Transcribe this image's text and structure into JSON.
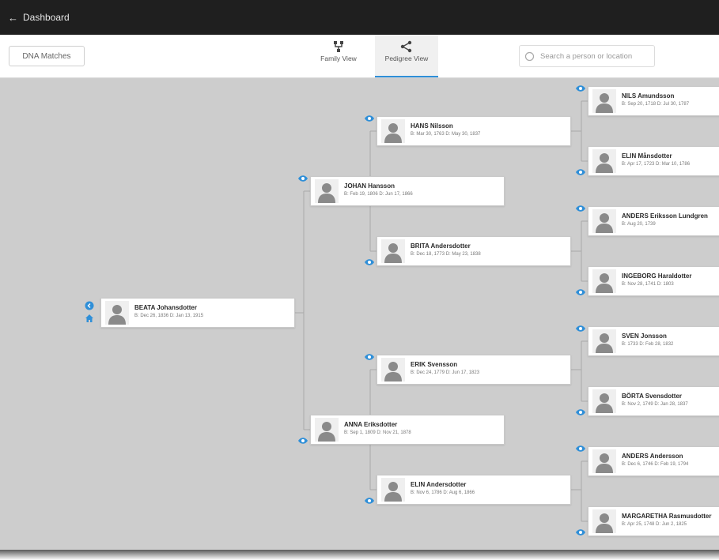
{
  "topbar": {
    "back_label": "Dashboard"
  },
  "toolbar": {
    "dna_button": "DNA Matches",
    "views": [
      {
        "label": "Family View",
        "active": false
      },
      {
        "label": "Pedigree View",
        "active": true
      }
    ],
    "search_placeholder": "Search a person or location"
  },
  "colors": {
    "accent": "#2f8fd8",
    "canvas": "#cdcdcd",
    "topbar": "#1f1f1f"
  },
  "icons": {
    "back": "arrow-left-icon",
    "family_view": "family-tree-icon",
    "pedigree_view": "pedigree-share-icon",
    "search": "search-icon",
    "focus": "target-circle-icon",
    "home": "home-icon",
    "eye": "eye-icon",
    "avatar": "person-silhouette-icon"
  },
  "tree": {
    "root": {
      "name": "BEATA Johansdotter",
      "dates": "B: Dec 26, 1836 D: Jan 13, 1915"
    },
    "parents": [
      {
        "name": "JOHAN Hansson",
        "dates": "B: Feb 19, 1806 D: Jun 17, 1866"
      },
      {
        "name": "ANNA Eriksdotter",
        "dates": "B: Sep 1, 1809 D: Nov 21, 1878"
      }
    ],
    "grandparents": [
      {
        "name": "HANS Nilsson",
        "dates": "B: Mar 30, 1763 D: May 30, 1837"
      },
      {
        "name": "BRITA Andersdotter",
        "dates": "B: Dec 18, 1773 D: May 23, 1838"
      },
      {
        "name": "ERIK Svensson",
        "dates": "B: Dec 24, 1779 D: Jun 17, 1823"
      },
      {
        "name": "ELIN Andersdotter",
        "dates": "B: Nov 6, 1786 D: Aug 6, 1866"
      }
    ],
    "great_grandparents": [
      {
        "name": "NILS Amundsson",
        "dates": "B: Sep 20, 1718 D: Jul 30, 1787"
      },
      {
        "name": "ELIN Månsdotter",
        "dates": "B: Apr 17, 1723 D: Mar 10, 1786"
      },
      {
        "name": "ANDERS Eriksson Lundgren",
        "dates": "B: Aug 20, 1739"
      },
      {
        "name": "INGEBORG Haraldotter",
        "dates": "B: Nov 28, 1741 D: 1803"
      },
      {
        "name": "SVEN Jonsson",
        "dates": "B: 1733 D: Feb 28, 1832"
      },
      {
        "name": "BÖRTA Svensdotter",
        "dates": "B: Nov 2, 1749 D: Jan 28, 1837"
      },
      {
        "name": "ANDERS Andersson",
        "dates": "B: Dec 6, 1746 D: Feb 19, 1794"
      },
      {
        "name": "MARGARETHA Rasmusdotter",
        "dates": "B: Apr 25, 1748 D: Jun 2, 1825"
      }
    ]
  }
}
